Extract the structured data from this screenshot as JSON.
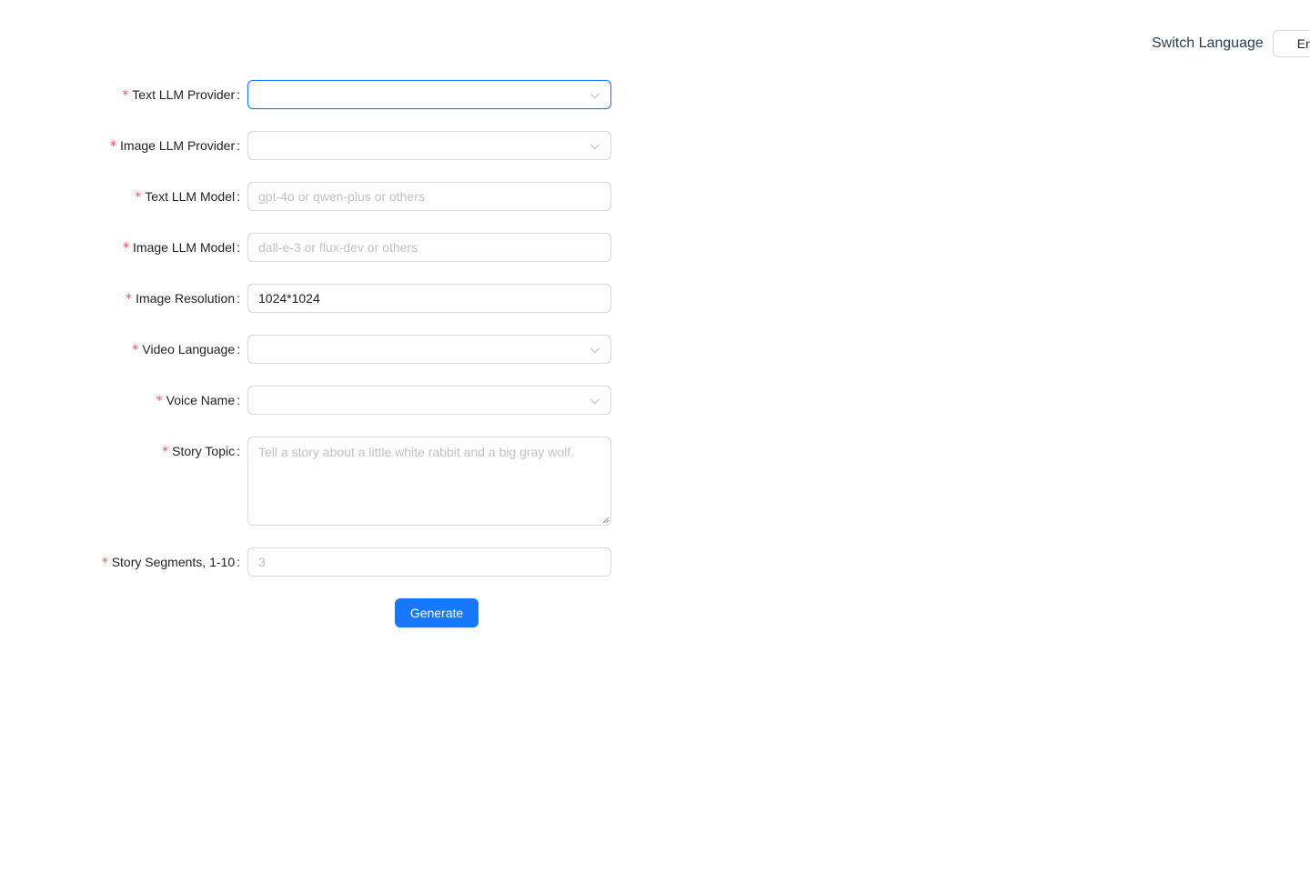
{
  "header": {
    "switch_language_label": "Switch Language",
    "language_select_value": "En"
  },
  "form": {
    "text_llm_provider": {
      "label": "Text LLM Provider",
      "value": ""
    },
    "image_llm_provider": {
      "label": "Image LLM Provider",
      "value": ""
    },
    "text_llm_model": {
      "label": "Text LLM Model",
      "placeholder": "gpt-4o or qwen-plus or others",
      "value": ""
    },
    "image_llm_model": {
      "label": "Image LLM Model",
      "placeholder": "dall-e-3 or flux-dev or others",
      "value": ""
    },
    "image_resolution": {
      "label": "Image Resolution",
      "value": "1024*1024"
    },
    "video_language": {
      "label": "Video Language",
      "value": ""
    },
    "voice_name": {
      "label": "Voice Name",
      "value": ""
    },
    "story_topic": {
      "label": "Story Topic",
      "placeholder": "Tell a story about a little white rabbit and a big gray wolf."
    },
    "story_segments": {
      "label": "Story Segments, 1-10",
      "placeholder": "3"
    },
    "generate_label": "Generate"
  },
  "colors": {
    "primary": "#1677ff",
    "required": "#ff4d4f",
    "border": "#d9d9d9"
  },
  "icons": {
    "select_arrow": "chevron-down-icon"
  }
}
